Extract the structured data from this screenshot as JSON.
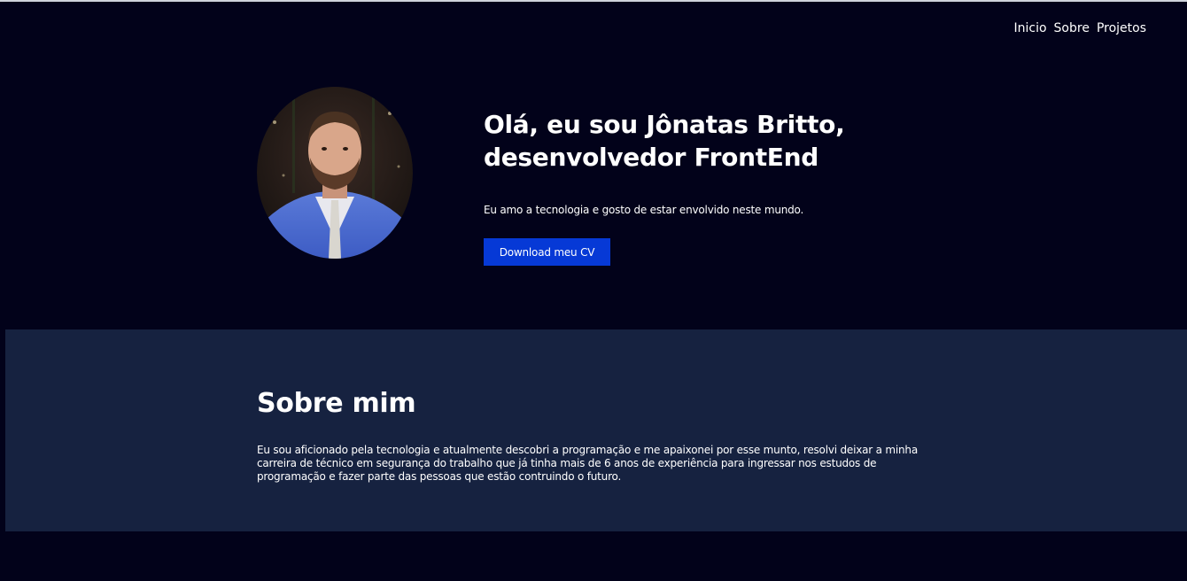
{
  "nav": {
    "items": [
      {
        "label": "Inicio"
      },
      {
        "label": "Sobre"
      },
      {
        "label": "Projetos"
      }
    ]
  },
  "hero": {
    "avatar_icon": "profile-photo",
    "title": "Olá, eu sou Jônatas Britto, desenvolvedor FrontEnd",
    "subtitle": "Eu amo a tecnologia e gosto de estar envolvido neste mundo.",
    "cv_button_label": "Download meu CV"
  },
  "about": {
    "title": "Sobre mim",
    "text": "Eu sou aficionado pela tecnologia e atualmente descobri a programação e me apaixonei por esse munto, resolvi deixar a minha carreira de técnico em segurança do trabalho que já tinha mais de 6 anos de experiência para ingressar nos estudos de programação e fazer parte das pessoas que estão contruindo o futuro."
  },
  "colors": {
    "background": "#02021a",
    "about_background": "#162240",
    "button": "#0639d6",
    "text": "#ffffff"
  }
}
